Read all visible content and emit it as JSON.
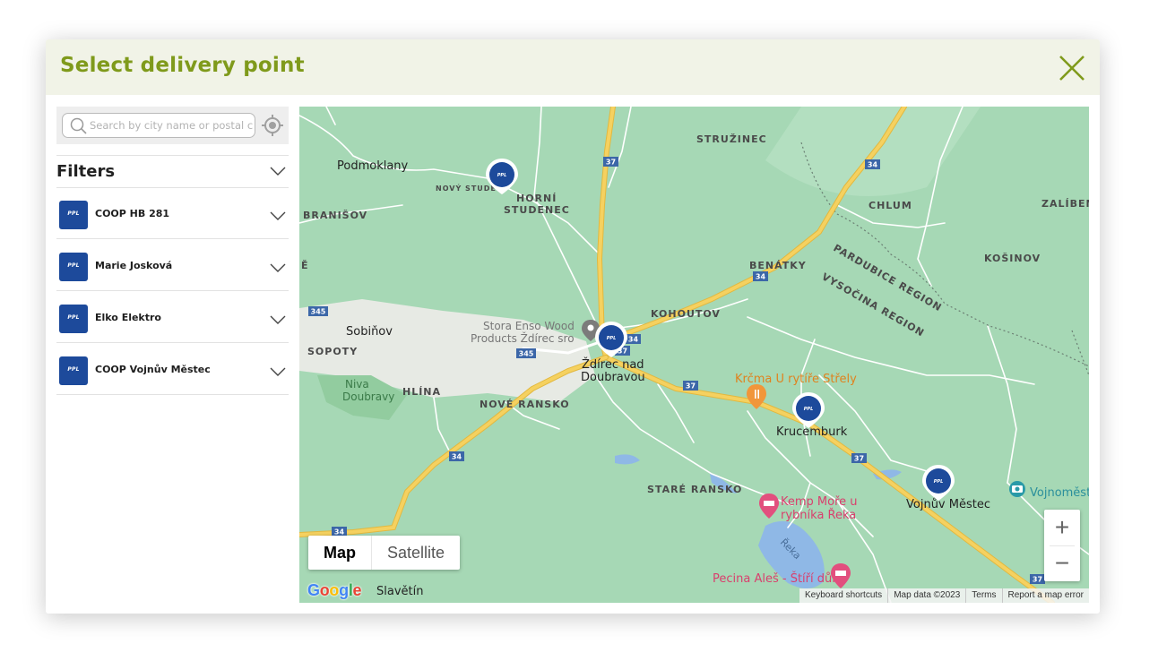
{
  "modal": {
    "title": "Select delivery point"
  },
  "search": {
    "placeholder": "Search by city name or postal code"
  },
  "filters": {
    "label": "Filters"
  },
  "points": [
    {
      "name": "COOP HB 281",
      "logo": "PPL"
    },
    {
      "name": "Marie Josková",
      "logo": "PPL"
    },
    {
      "name": "Elko Elektro",
      "logo": "PPL"
    },
    {
      "name": "COOP Vojnův Městec",
      "logo": "PPL"
    }
  ],
  "map": {
    "type_buttons": {
      "map": "Map",
      "satellite": "Satellite"
    },
    "zoom": {
      "in": "+",
      "out": "−"
    },
    "attribution": {
      "keyboard": "Keyboard shortcuts",
      "map_data": "Map data ©2023",
      "terms": "Terms",
      "report": "Report a map error"
    },
    "google_letters": [
      "G",
      "o",
      "o",
      "g",
      "l",
      "e"
    ],
    "labels": {
      "struzinec": "STRUŽINEC",
      "podmoklany": "Podmoklany",
      "novy_studenec": "NOVÝ STUDE",
      "horni": "HORNÍ",
      "studenec": "STUDENEC",
      "branisov": "BRANIŠOV",
      "chlum": "CHLUM",
      "zaliben": "ZALÍBEN",
      "kosinov": "KOŠINOV",
      "benatky": "BENÁTKY",
      "pardubice_region": "PARDUBICE REGION",
      "vysocina_region": "VYSOČINA REGION",
      "kohoutov": "KOHOUTOV",
      "e_edge": "Ě",
      "sobinov": "Sobiňov",
      "sopoty": "SOPOTY",
      "stora_1": "Stora Enso Wood",
      "stora_2": "Products Ždírec sro",
      "zdirec_1": "Ždírec nad",
      "zdirec_2": "Doubravou",
      "krcma": "Krčma U rytíře Střely",
      "niva_1": "Niva",
      "niva_2": "Doubravy",
      "hlina": "HLÍNA",
      "nove_ransko": "NOVÉ RANSKO",
      "krucemburk": "Krucemburk",
      "stare_ransko": "STARÉ RANSKO",
      "kemp_1": "Kemp Moře u",
      "kemp_2": "rybníka Řeka",
      "vojnuv": "Vojnův Městec",
      "vojnomest": "Vojnoměst",
      "reka": "Řeka",
      "pecina": "Pecina Aleš - Štíří důl",
      "slavetin": "Slavětín"
    },
    "road_shields": {
      "r37a": "37",
      "r34a": "34",
      "r345a": "345",
      "r345b": "345",
      "r34b": "34",
      "r37b": "37",
      "r34c": "34",
      "r37c": "37",
      "r37d": "37",
      "r34d": "34",
      "r34e": "34"
    },
    "marker_logo": "PPL",
    "colors": {
      "land": "#a6d8b5",
      "urban": "#e7eae4",
      "major_road": "#f5d160",
      "water": "#8fb8e6",
      "marker": "#1d4a9b",
      "accent": "#7f9a1b"
    }
  }
}
